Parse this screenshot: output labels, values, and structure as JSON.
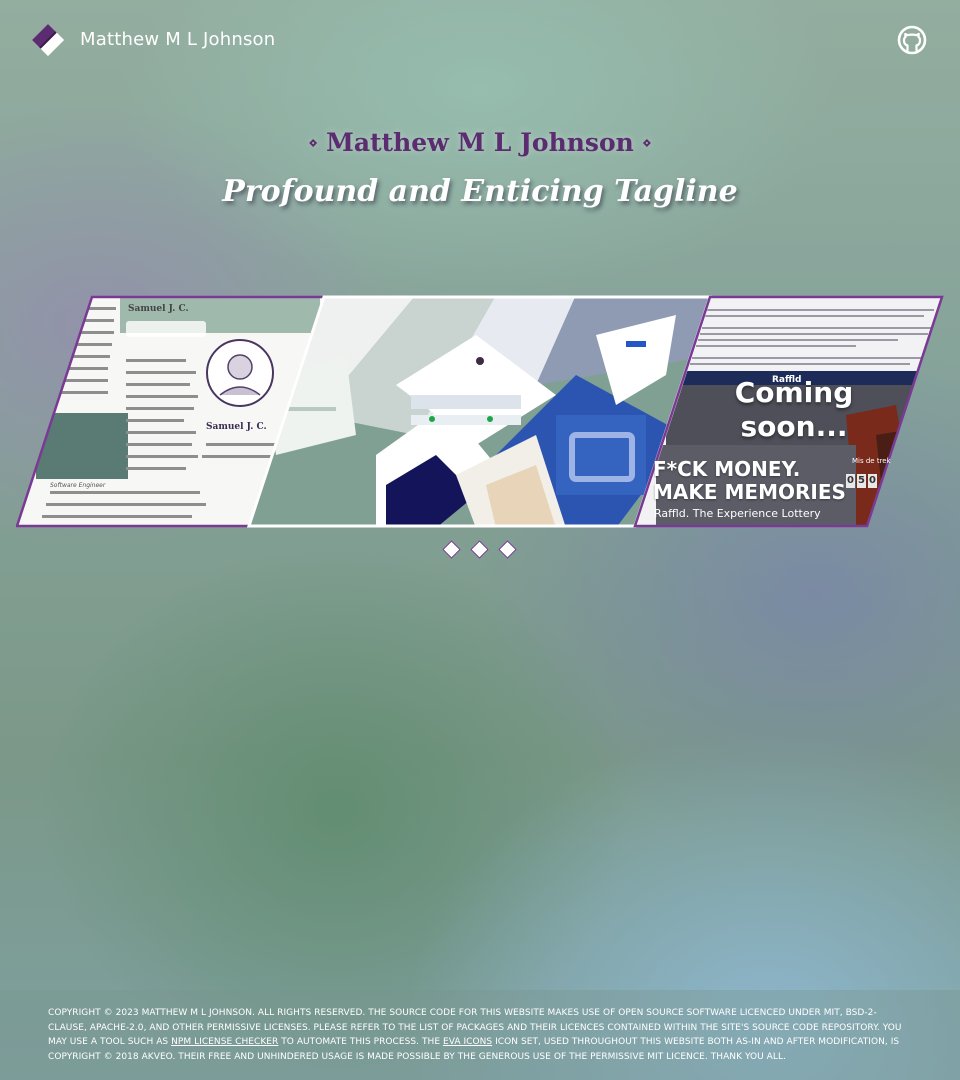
{
  "header": {
    "site_name": "Matthew M L Johnson",
    "logo_icon": "brand-logo-icon",
    "github_icon": "github-icon"
  },
  "hero": {
    "title": "Matthew M L Johnson",
    "title_ornament": "⋄",
    "tagline": "Profound and Enticing Tagline"
  },
  "carousel": {
    "slides": [
      {
        "name": "Samuel profile",
        "heading": "Samuel J. C.",
        "role": "Software Engineer"
      },
      {
        "name": "App screenshots"
      },
      {
        "name": "Raffld",
        "overlay": "Coming soon...",
        "overlay_line1": "Coming",
        "overlay_line2": "soon...",
        "brand": "Raffld",
        "headline_line1": "F*CK MONEY.",
        "headline_line2": "MAKE MEMORIES",
        "subline": "Raffld. The Experience Lottery",
        "countdown_label": "Mis de trek",
        "countdown_digits": [
          "0",
          "5",
          "0"
        ]
      }
    ],
    "dots_count": 3,
    "active_dot": 0
  },
  "footer": {
    "text_1": "Copyright © 2023 Matthew M L Johnson. All rights reserved. The source code for this website makes use of open source software licenced under MIT, BSD-2-Clause, Apache-2.0, and other permissive licenses. Please refer to the list of packages and their licences contained within the site's source code repository. You may use a tool such as ",
    "link_1": "npm license checker",
    "text_2": " to automate this process. The ",
    "link_2": "Eva Icons",
    "text_3": " icon set, used throughout this website both as-in and after modification, is copyright © 2018 Akveo. Their free and unhindered usage is made possible by the generous use of the permissive MIT licence. Thank you all."
  },
  "colors": {
    "accent": "#5b2c6f",
    "accent_border": "#7a3a94",
    "text_light": "#ffffff"
  }
}
